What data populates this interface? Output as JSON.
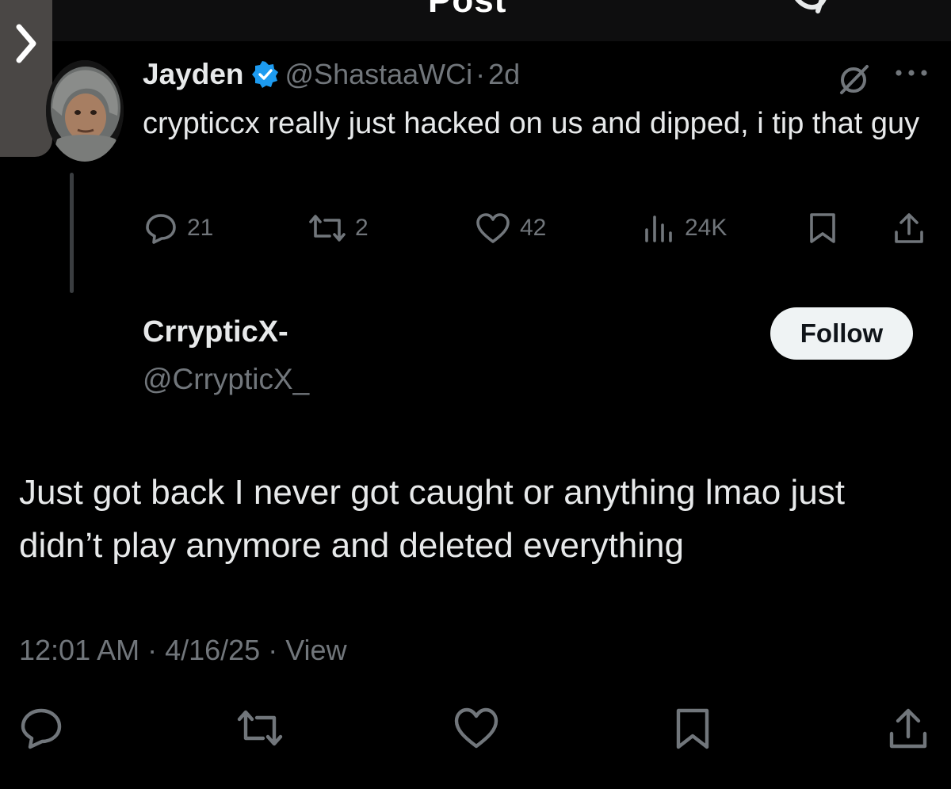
{
  "topbar": {
    "title": "Post"
  },
  "reply": {
    "name": "Jayden",
    "verified_color": "#1d9bf0",
    "handle": "@ShastaaWCi",
    "separator": "·",
    "age": "2d",
    "text": "crypticcx really just hacked on us and dipped, i tip that guy",
    "actions": {
      "replies": "21",
      "reposts": "2",
      "likes": "42",
      "views": "24K"
    }
  },
  "post": {
    "author_name": "CrrypticX-",
    "author_handle": "@CrrypticX_",
    "follow_label": "Follow",
    "text": "Just got back I never got caught or anything lmao just didn’t play anymore and deleted everything",
    "timestamp": "12:01 AM · 4/16/25 · View"
  },
  "colors": {
    "background": "#000000",
    "text_primary": "#e7e9ea",
    "text_secondary": "#71767b",
    "follow_bg": "#eff3f4"
  },
  "icons": [
    "chevron-right-icon",
    "grok-icon",
    "verified-badge-icon",
    "more-icon",
    "reply-icon",
    "repost-icon",
    "like-icon",
    "views-icon",
    "bookmark-icon",
    "share-icon"
  ]
}
